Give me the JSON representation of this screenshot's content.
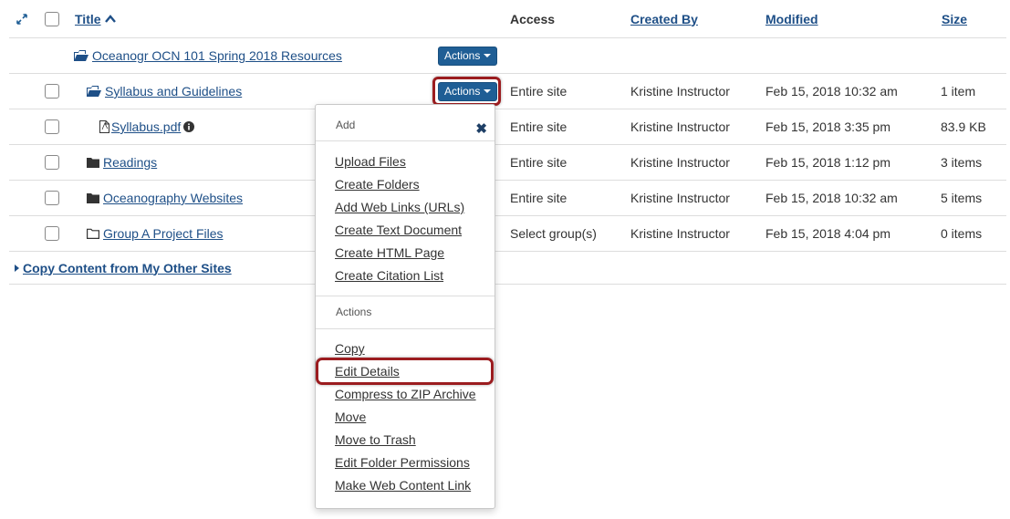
{
  "header": {
    "title": "Title",
    "access": "Access",
    "created_by": "Created By",
    "modified": "Modified",
    "size": "Size"
  },
  "root_row": {
    "title": "Oceanogr OCN 101 Spring 2018 Resources",
    "actions_label": "Actions"
  },
  "rows": [
    {
      "title": "Syllabus and Guidelines",
      "access": "Entire site",
      "created_by": "Kristine Instructor",
      "modified": "Feb 15, 2018 10:32 am",
      "size": "1 item",
      "actions_label": "Actions"
    },
    {
      "title": "Syllabus.pdf",
      "access": "Entire site",
      "created_by": "Kristine Instructor",
      "modified": "Feb 15, 2018 3:35 pm",
      "size": "83.9 KB"
    },
    {
      "title": "Readings",
      "access": "Entire site",
      "created_by": "Kristine Instructor",
      "modified": "Feb 15, 2018 1:12 pm",
      "size": "3 items"
    },
    {
      "title": "Oceanography Websites",
      "access": "Entire site",
      "created_by": "Kristine Instructor",
      "modified": "Feb 15, 2018 10:32 am",
      "size": "5 items"
    },
    {
      "title": "Group A Project Files",
      "access": "Select group(s)",
      "created_by": "Kristine Instructor",
      "modified": "Feb 15, 2018 4:04 pm",
      "size": "0 items"
    }
  ],
  "copy_content_label": "Copy Content from My Other Sites",
  "menu": {
    "add_header": "Add",
    "add_items": [
      "Upload Files",
      "Create Folders",
      "Add Web Links (URLs)",
      "Create Text Document",
      "Create HTML Page",
      "Create Citation List"
    ],
    "actions_header": "Actions",
    "action_items": [
      "Copy",
      "Edit Details",
      "Compress to ZIP Archive",
      "Move",
      "Move to Trash",
      "Edit Folder Permissions",
      "Make Web Content Link"
    ]
  },
  "colors": {
    "link": "#1e4f87",
    "button": "#1f5e95",
    "highlight": "#9b1c1f"
  },
  "icons": [
    "expand-icon",
    "sort-up-icon",
    "folder-open-icon",
    "folder-icon",
    "folder-outline-icon",
    "file-pdf-icon",
    "info-icon",
    "close-icon",
    "caret-right-icon"
  ]
}
